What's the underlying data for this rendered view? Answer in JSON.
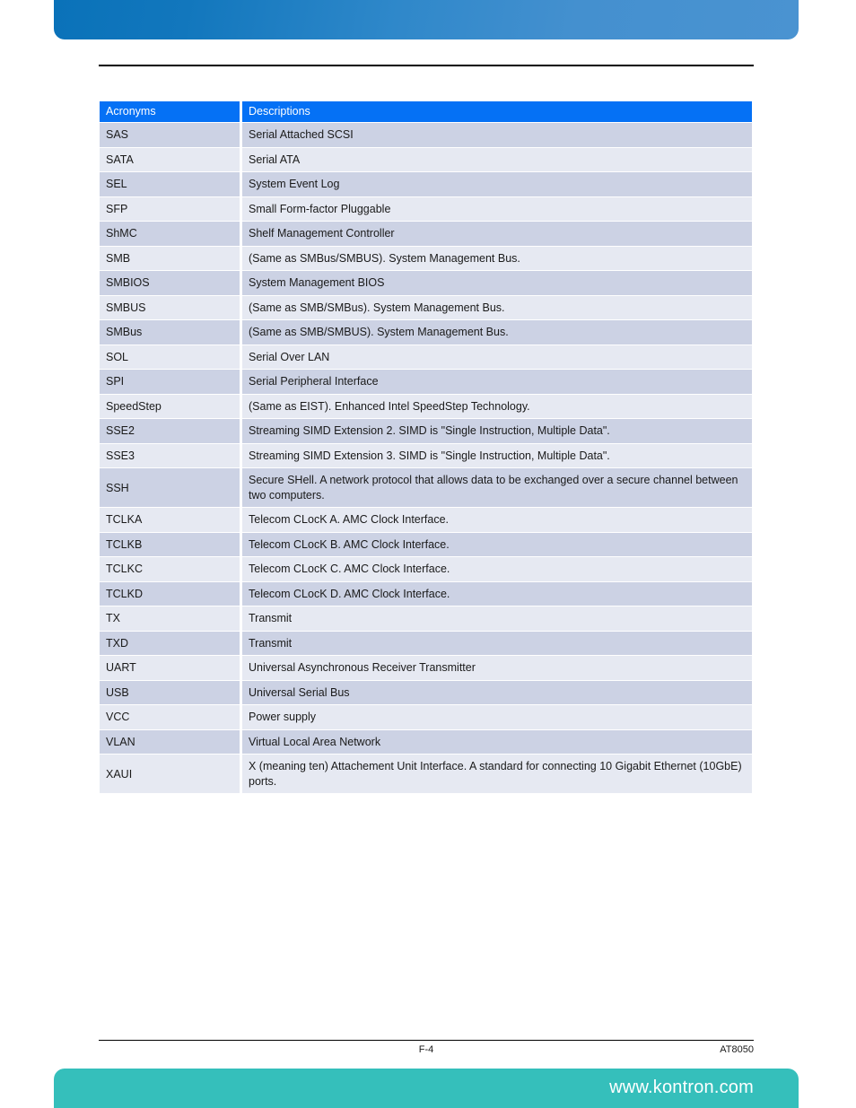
{
  "page": {
    "brand_accent": "#35bfbb",
    "header_accent": "#1277bd",
    "table_header_color": "#0571f5"
  },
  "table": {
    "columns": [
      "Acronyms",
      "Descriptions"
    ],
    "rows": [
      {
        "acronym": "SAS",
        "description": "Serial Attached SCSI"
      },
      {
        "acronym": "SATA",
        "description": "Serial ATA"
      },
      {
        "acronym": "SEL",
        "description": "System Event Log"
      },
      {
        "acronym": "SFP",
        "description": "Small Form-factor Pluggable"
      },
      {
        "acronym": "ShMC",
        "description": "Shelf Management Controller"
      },
      {
        "acronym": "SMB",
        "description": "(Same as SMBus/SMBUS). System Management Bus."
      },
      {
        "acronym": "SMBIOS",
        "description": "System Management BIOS"
      },
      {
        "acronym": "SMBUS",
        "description": "(Same as SMB/SMBus). System Management Bus."
      },
      {
        "acronym": "SMBus",
        "description": "(Same as SMB/SMBUS). System Management Bus."
      },
      {
        "acronym": "SOL",
        "description": "Serial Over LAN"
      },
      {
        "acronym": "SPI",
        "description": "Serial Peripheral Interface"
      },
      {
        "acronym": "SpeedStep",
        "description": "(Same as EIST). Enhanced Intel SpeedStep Technology."
      },
      {
        "acronym": "SSE2",
        "description": "Streaming SIMD Extension 2. SIMD is \"Single Instruction, Multiple Data\"."
      },
      {
        "acronym": "SSE3",
        "description": "Streaming SIMD Extension 3. SIMD is \"Single Instruction, Multiple Data\"."
      },
      {
        "acronym": "SSH",
        "description": "Secure SHell. A network protocol that allows data to be exchanged over a secure channel between two computers."
      },
      {
        "acronym": "TCLKA",
        "description": "Telecom CLocK A. AMC Clock Interface."
      },
      {
        "acronym": "TCLKB",
        "description": "Telecom CLocK B. AMC Clock Interface."
      },
      {
        "acronym": "TCLKC",
        "description": "Telecom CLocK C. AMC Clock Interface."
      },
      {
        "acronym": "TCLKD",
        "description": "Telecom CLocK D. AMC Clock Interface."
      },
      {
        "acronym": "TX",
        "description": "Transmit"
      },
      {
        "acronym": "TXD",
        "description": "Transmit"
      },
      {
        "acronym": "UART",
        "description": "Universal Asynchronous Receiver Transmitter"
      },
      {
        "acronym": "USB",
        "description": "Universal Serial Bus"
      },
      {
        "acronym": "VCC",
        "description": "Power supply"
      },
      {
        "acronym": "VLAN",
        "description": "Virtual Local Area Network"
      },
      {
        "acronym": "XAUI",
        "description": "X (meaning ten) Attachement Unit Interface. A standard for connecting 10 Gigabit Ethernet (10GbE) ports."
      }
    ]
  },
  "footer": {
    "page_number": "F-4",
    "document": "AT8050",
    "url": "www.kontron.com"
  }
}
